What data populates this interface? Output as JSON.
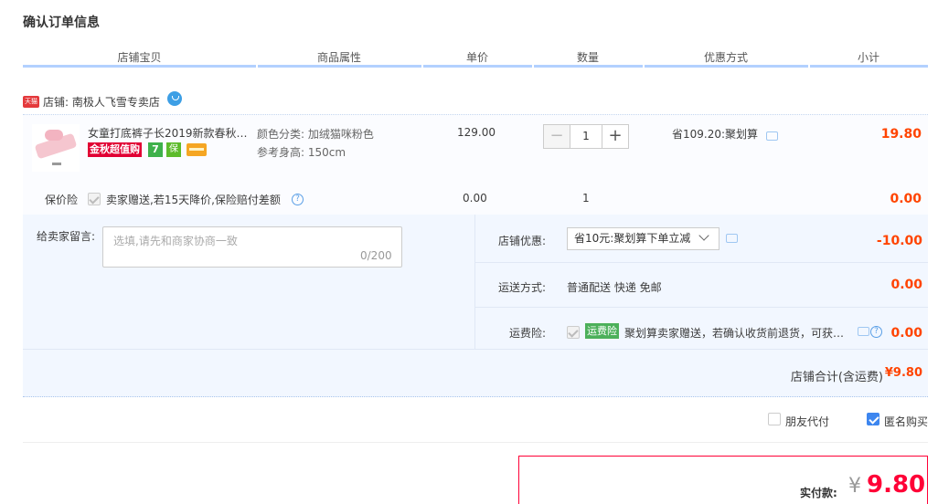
{
  "page_title": "确认订单信息",
  "columns": [
    "店铺宝贝",
    "商品属性",
    "单价",
    "数量",
    "优惠方式",
    "小计"
  ],
  "shop": {
    "badge": "天猫",
    "label": "店铺: 南极人飞雪专卖店"
  },
  "item": {
    "title": "女童打底裤子长2019新款春秋…",
    "promo_tag": "金秋超值购",
    "icon_seven": "7",
    "icon_shield": "保",
    "attr_color": "颜色分类: 加绒猫咪粉色",
    "attr_height": "参考身高: 150cm",
    "price": "129.00",
    "quantity": "1",
    "minus": "−",
    "plus": "+",
    "discount": "省109.20:聚划算",
    "subtotal": "19.80"
  },
  "insurance": {
    "label": "保价险",
    "text": "卖家赠送,若15天降价,保险赔付差额",
    "help": "?",
    "price": "0.00",
    "qty": "1",
    "subtotal": "0.00"
  },
  "message": {
    "label": "给卖家留言:",
    "placeholder": "选填,请先和商家协商一致",
    "count": "0/200"
  },
  "shop_discount": {
    "label": "店铺优惠:",
    "selected": "省10元:聚划算下单立减",
    "value": "-10.00"
  },
  "shipping": {
    "label": "运送方式:",
    "value": "普通配送 快递 免邮",
    "price": "0.00"
  },
  "freight_insurance": {
    "label": "运费险:",
    "tag": "运费险",
    "text": "聚划算卖家赠送，若确认收货前退货，可获…",
    "help": "?",
    "price": "0.00"
  },
  "shop_total": {
    "label": "店铺合计(含运费)",
    "value": "¥9.80"
  },
  "options": {
    "friend_pay": "朋友代付",
    "anonymous": "匿名购买"
  },
  "payment": {
    "label": "实付款:",
    "currency": "¥",
    "value": "9.80"
  },
  "colors": {
    "accent_red": "#ff4400",
    "header_line": "#b2d1ff",
    "pay_border": "#ff0036"
  }
}
